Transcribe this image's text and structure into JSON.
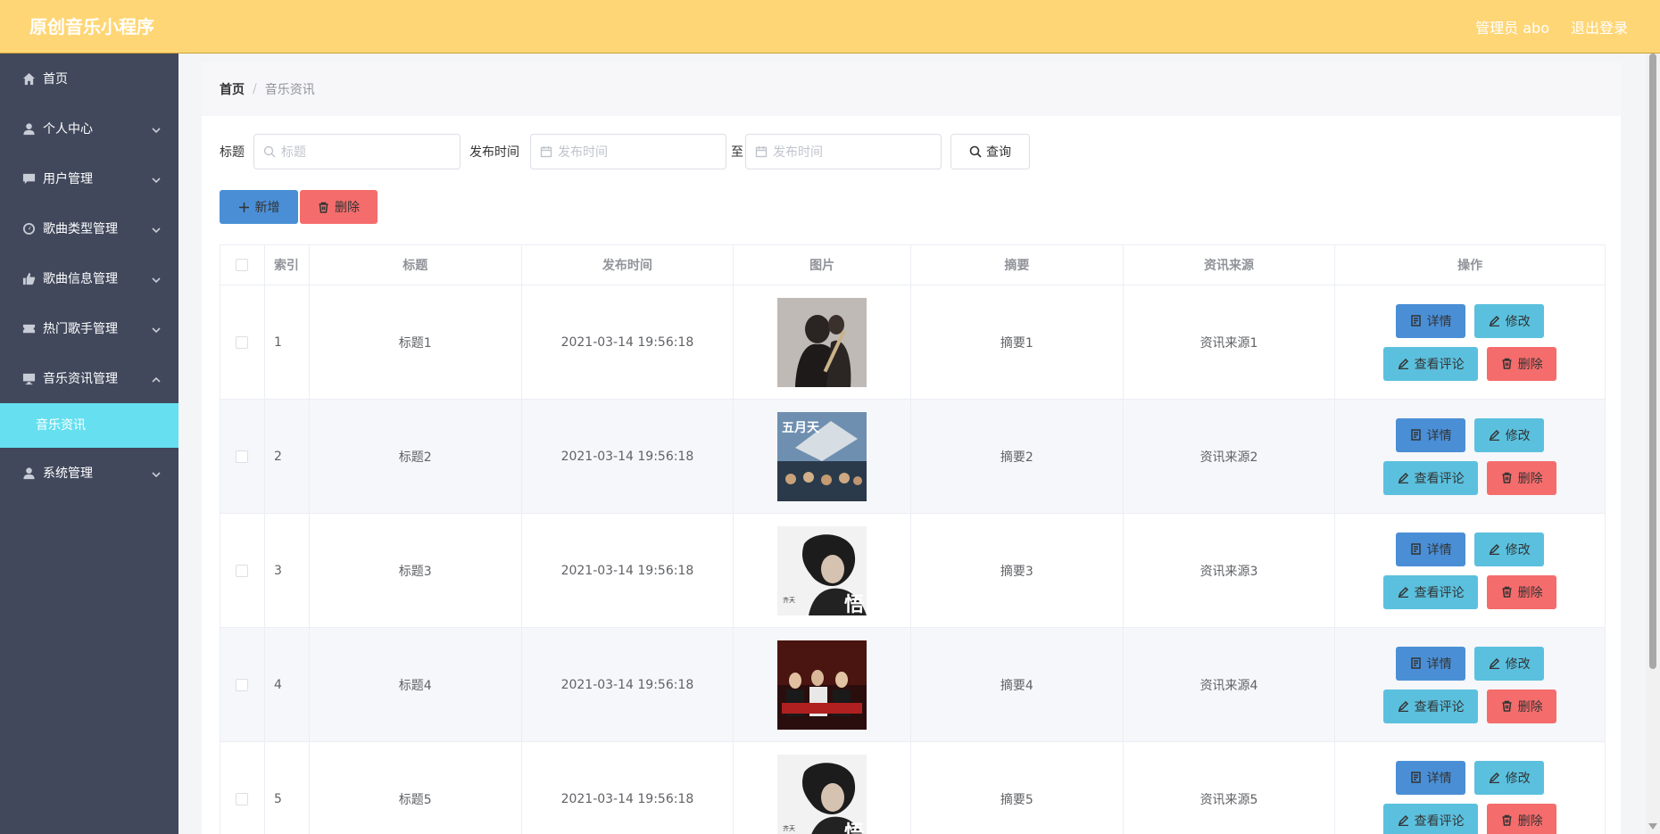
{
  "app": {
    "title": "原创音乐小程序",
    "user": "管理员 abo",
    "logout": "退出登录"
  },
  "sidebar": {
    "items": [
      {
        "label": "首页",
        "icon": "home-icon"
      },
      {
        "label": "个人中心",
        "icon": "user-icon"
      },
      {
        "label": "用户管理",
        "icon": "chat-icon"
      },
      {
        "label": "歌曲类型管理",
        "icon": "gauge-icon"
      },
      {
        "label": "歌曲信息管理",
        "icon": "thumbs-up-icon"
      },
      {
        "label": "热门歌手管理",
        "icon": "ticket-icon"
      },
      {
        "label": "音乐资讯管理",
        "icon": "monitor-icon"
      },
      {
        "label": "系统管理",
        "icon": "user-icon"
      }
    ],
    "submenu": {
      "label": "音乐资讯"
    }
  },
  "breadcrumb": {
    "home": "首页",
    "separator": "/",
    "current": "音乐资讯"
  },
  "search": {
    "title_label": "标题",
    "title_placeholder": "标题",
    "time_label": "发布时间",
    "time_start_placeholder": "发布时间",
    "to_label": "至",
    "time_end_placeholder": "发布时间",
    "query_label": "查询"
  },
  "actions": {
    "add_label": "新增",
    "delete_label": "删除"
  },
  "table": {
    "headers": [
      "索引",
      "标题",
      "发布时间",
      "图片",
      "摘要",
      "资讯来源",
      "操作"
    ],
    "rows": [
      {
        "index": "1",
        "title": "标题1",
        "time": "2021-03-14 19:56:18",
        "summary": "摘要1",
        "source": "资讯来源1"
      },
      {
        "index": "2",
        "title": "标题2",
        "time": "2021-03-14 19:56:18",
        "summary": "摘要2",
        "source": "资讯来源2"
      },
      {
        "index": "3",
        "title": "标题3",
        "time": "2021-03-14 19:56:18",
        "summary": "摘要3",
        "source": "资讯来源3"
      },
      {
        "index": "4",
        "title": "标题4",
        "time": "2021-03-14 19:56:18",
        "summary": "摘要4",
        "source": "资讯来源4"
      },
      {
        "index": "5",
        "title": "标题5",
        "time": "2021-03-14 19:56:18",
        "summary": "摘要5",
        "source": "资讯来源5"
      }
    ],
    "ops": {
      "detail": "详情",
      "edit": "修改",
      "comments": "查看评论",
      "delete": "删除"
    }
  },
  "colors": {
    "topbar": "#ffd675",
    "sidebar": "#41485c",
    "submenu_active": "#66e0f0",
    "btn_blue": "#4a8fd6",
    "btn_cyan": "#5bc0de",
    "btn_red": "#f56c6c"
  }
}
